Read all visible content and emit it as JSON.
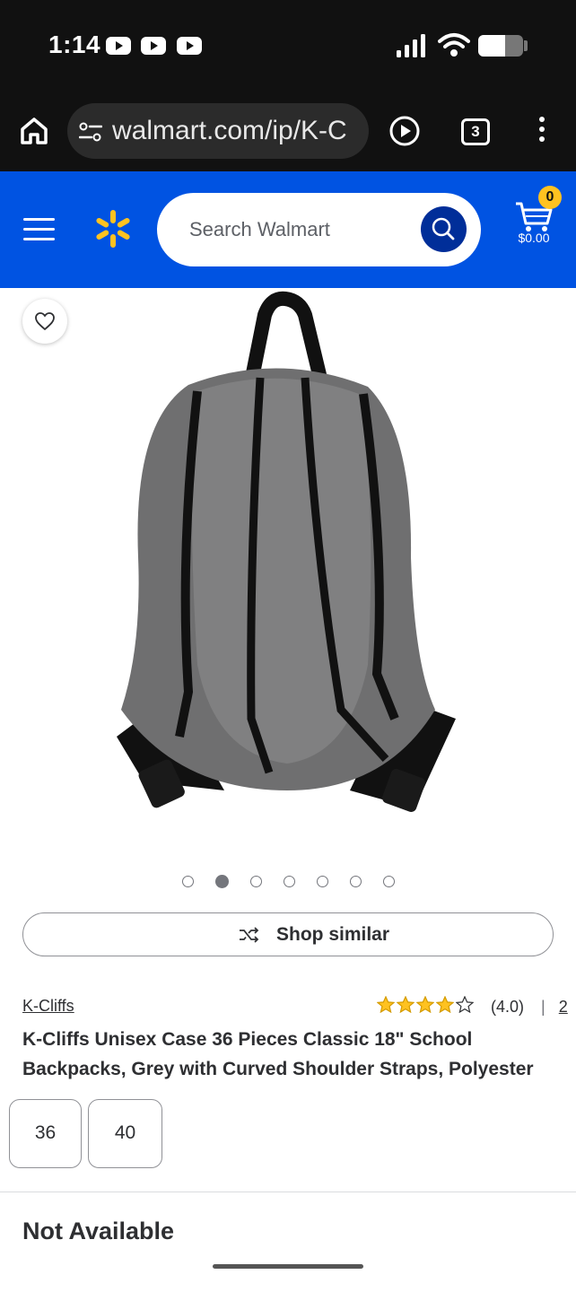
{
  "status_bar": {
    "time": "1:14",
    "notification_icons": [
      "youtube-icon",
      "youtube-icon",
      "youtube-icon"
    ],
    "battery_level": 0.6
  },
  "browser": {
    "url": "walmart.com/ip/K-C",
    "tab_count": "3"
  },
  "header": {
    "search_placeholder": "Search Walmart",
    "cart_count": "0",
    "cart_total": "$0.00",
    "brand_color": "#0053e2",
    "spark_color": "#ffc220"
  },
  "gallery": {
    "image_count": 7,
    "active_index": 1
  },
  "shop_similar": {
    "label": "Shop similar"
  },
  "product": {
    "brand": "K-Cliffs",
    "rating_stars": 4,
    "rating_text": "(4.0)",
    "separator": "|",
    "review_count": "2",
    "title": "K-Cliffs Unisex Case 36 Pieces Classic 18\" School Backpacks, Grey with Curved Shoulder Straps, Polyester",
    "variants": [
      "36",
      "40"
    ]
  },
  "availability": {
    "status": "Not Available"
  }
}
